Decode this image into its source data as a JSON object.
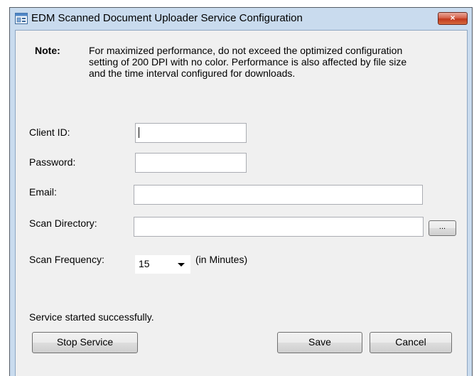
{
  "window": {
    "title": "EDM Scanned Document Uploader Service Configuration",
    "close_label": "×"
  },
  "note": {
    "heading": "Note:",
    "text": "For maximized performance, do not exceed the optimized configuration setting of  200 DPI with no color. Performance is also affected by file size and the time interval configured for downloads."
  },
  "form": {
    "client_id_label": "Client ID:",
    "client_id_value": "",
    "password_label": "Password:",
    "password_value": "",
    "email_label": "Email:",
    "email_value": "",
    "scan_directory_label": "Scan Directory:",
    "scan_directory_value": "",
    "browse_label": "...",
    "scan_frequency_label": "Scan Frequency:",
    "scan_frequency_value": "15",
    "scan_frequency_unit": "(in Minutes)"
  },
  "status": "Service started successfully.",
  "buttons": {
    "stop_service": "Stop Service",
    "save": "Save",
    "cancel": "Cancel"
  },
  "icons": {
    "app": "app-window-icon",
    "dropdown": "chevron-down-icon"
  },
  "colors": {
    "title_bar": "#c9dbee",
    "client_bg": "#f0f0f0",
    "close_button": "#c8452b"
  }
}
